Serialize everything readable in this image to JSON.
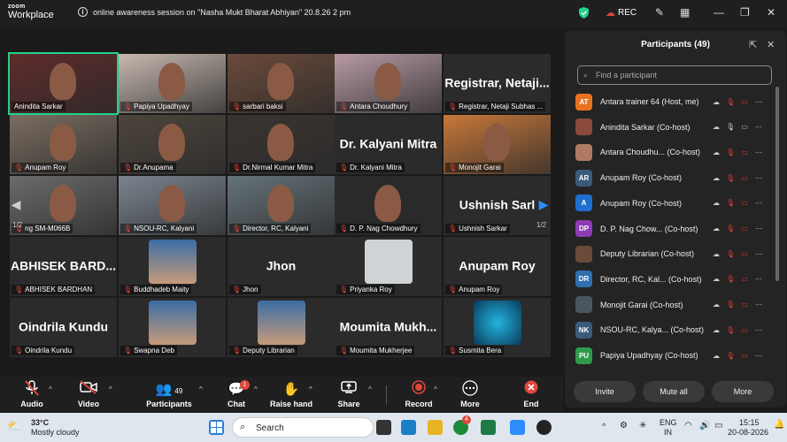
{
  "app": {
    "logo_top": "zoom",
    "logo_bottom": "Workplace"
  },
  "meeting": {
    "title": "online awareness session on \"Nasha Mukt Bharat Abhiyan\" 20.8.26 2 pm",
    "rec_label": "REC"
  },
  "gallery": {
    "page_left": "1/2",
    "page_right": "1/2",
    "tiles": [
      {
        "big": "",
        "caption": "Anindita Sarkar",
        "mic": false
      },
      {
        "big": "",
        "caption": "Papiya Upadhyay",
        "mic": true
      },
      {
        "big": "",
        "caption": "sarbari baksi",
        "mic": true
      },
      {
        "big": "",
        "caption": "Antara Choudhury",
        "mic": true
      },
      {
        "big": "Registrar, Netaji...",
        "caption": "Registrar, Netaji Subhas ...",
        "mic": true
      },
      {
        "big": "",
        "caption": "Anupam Roy",
        "mic": true
      },
      {
        "big": "",
        "caption": "Dr.Anupama",
        "mic": true
      },
      {
        "big": "",
        "caption": "Dr.Nirmal Kumar Mitra",
        "mic": true
      },
      {
        "big": "Dr. Kalyani Mitra",
        "caption": "Dr. Kalyani Mitra",
        "mic": true
      },
      {
        "big": "",
        "caption": "Monojit Garai",
        "mic": true
      },
      {
        "big": "",
        "caption": "ng SM-M066B",
        "mic": true
      },
      {
        "big": "",
        "caption": "NSOU-RC, Kalyani",
        "mic": true
      },
      {
        "big": "",
        "caption": "Director, RC, Kalyani",
        "mic": true
      },
      {
        "big": "",
        "caption": "D. P. Nag Chowdhury",
        "mic": true
      },
      {
        "big": "Ushnish Sarl",
        "caption": "Ushnish Sarkar",
        "mic": true
      },
      {
        "big": "ABHISEK BARD...",
        "caption": "ABHISEK BARDHAN",
        "mic": true
      },
      {
        "big": "",
        "caption": "Buddhadeb Maity",
        "mic": true
      },
      {
        "big": "Jhon",
        "caption": "Jhon",
        "mic": true
      },
      {
        "big": "",
        "caption": "Priyanka Roy",
        "mic": true
      },
      {
        "big": "Anupam Roy",
        "caption": "Anupam Roy",
        "mic": true
      },
      {
        "big": "Oindrila Kundu",
        "caption": "Oindrila Kundu",
        "mic": true
      },
      {
        "big": "",
        "caption": "Swapna Deb",
        "mic": true
      },
      {
        "big": "",
        "caption": "Deputy Librarian",
        "mic": true
      },
      {
        "big": "Moumita Mukh...",
        "caption": "Moumita Mukherjee",
        "mic": true
      },
      {
        "big": "",
        "caption": "Susmita Bera",
        "mic": true
      }
    ]
  },
  "toolbar": {
    "audio": "Audio",
    "video": "Video",
    "participants": "Participants",
    "participants_count": "49",
    "chat": "Chat",
    "chat_badge": "1",
    "raise_hand": "Raise hand",
    "share": "Share",
    "record": "Record",
    "more": "More",
    "end": "End"
  },
  "panel": {
    "title": "Participants (49)",
    "search_placeholder": "Find a participant",
    "participants": [
      {
        "initials": "AT",
        "color": "#e8731f",
        "name": "Antara trainer 64 (Host, me)",
        "photo": false
      },
      {
        "initials": "",
        "color": "#8a4b3b",
        "name": "Anindita Sarkar (Co-host)",
        "photo": true
      },
      {
        "initials": "",
        "color": "#b07a62",
        "name": "Antara Choudhu... (Co-host)",
        "photo": true
      },
      {
        "initials": "AR",
        "color": "#3c5a7a",
        "name": "Anupam Roy (Co-host)",
        "photo": false
      },
      {
        "initials": "A",
        "color": "#1f6fd1",
        "name": "Anupam Roy (Co-host)",
        "photo": false
      },
      {
        "initials": "DP",
        "color": "#8e3bb3",
        "name": "D. P. Nag Chow... (Co-host)",
        "photo": false
      },
      {
        "initials": "",
        "color": "#6b4a3a",
        "name": "Deputy Librarian (Co-host)",
        "photo": true
      },
      {
        "initials": "DR",
        "color": "#2e6fb0",
        "name": "Director, RC, Kal... (Co-host)",
        "photo": false
      },
      {
        "initials": "",
        "color": "#4a5560",
        "name": "Monojit Garai (Co-host)",
        "photo": true
      },
      {
        "initials": "NK",
        "color": "#3c5a7a",
        "name": "NSOU-RC, Kalya... (Co-host)",
        "photo": false
      },
      {
        "initials": "PU",
        "color": "#2f9a4a",
        "name": "Papiya Upadhyay (Co-host)",
        "photo": false
      }
    ],
    "invite": "Invite",
    "mute_all": "Mute all",
    "more": "More"
  },
  "taskbar": {
    "temp": "33°C",
    "weather": "Mostly cloudy",
    "search": "Search",
    "lang_top": "ENG",
    "lang_bottom": "IN",
    "time": "15:15",
    "date": "20-08-2026",
    "badge": "4"
  },
  "colors": {
    "accent": "#2d8cff",
    "green_frame": "#23d18b",
    "danger": "#e0463c"
  }
}
